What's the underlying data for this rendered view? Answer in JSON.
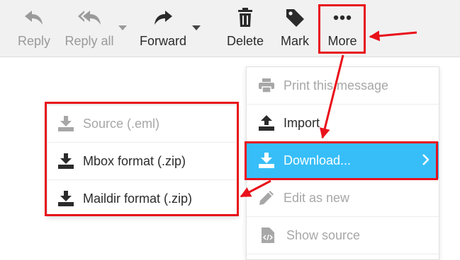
{
  "toolbar": {
    "reply": "Reply",
    "reply_all": "Reply all",
    "forward": "Forward",
    "delete": "Delete",
    "mark": "Mark",
    "more": "More"
  },
  "more_menu": {
    "items": [
      {
        "label": "Print this message",
        "icon": "print-icon",
        "state": "disabled"
      },
      {
        "label": "Import",
        "icon": "upload-icon",
        "state": "normal"
      },
      {
        "label": "Download...",
        "icon": "download-icon",
        "state": "active"
      },
      {
        "label": "Edit as new",
        "icon": "pencil-icon",
        "state": "disabled"
      },
      {
        "label": "Show source",
        "icon": "source-file-icon",
        "state": "disabled"
      }
    ]
  },
  "download_submenu": {
    "items": [
      {
        "label": "Source (.eml)",
        "icon": "download-icon",
        "state": "disabled"
      },
      {
        "label": "Mbox format (.zip)",
        "icon": "download-icon",
        "state": "normal"
      },
      {
        "label": "Maildir format (.zip)",
        "icon": "download-icon",
        "state": "normal"
      }
    ]
  },
  "colors": {
    "toolbar_bg": "#f1f1f1",
    "active_item": "#37bef8",
    "annotation": "#e8111a",
    "text": "#2b2b2b",
    "disabled_text": "#9a9a9a"
  }
}
